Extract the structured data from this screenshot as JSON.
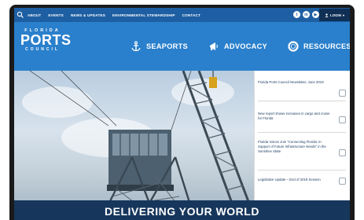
{
  "topbar": {
    "nav": [
      "ABOUT",
      "EVENTS",
      "NEWS & UPDATES",
      "ENVIRONMENTAL STEWARDSHIP",
      "CONTACT"
    ],
    "social": [
      {
        "icon": "twitter-icon",
        "glyph": "t"
      },
      {
        "icon": "linkedin-icon",
        "glyph": "in"
      },
      {
        "icon": "youtube-icon",
        "glyph": "▶"
      }
    ],
    "login_label": "LOGIN"
  },
  "logo": {
    "line1": "FLORIDA",
    "line2": "PORTS",
    "line3": "COUNCIL"
  },
  "mainnav": [
    "SEAPORTS",
    "ADVOCACY",
    "RESOURCES"
  ],
  "sidebar": {
    "items": [
      "Florida Ports Council Newsletter, June 2019",
      "New report shows increases in cargo and cruise for Florida",
      "Florida Voices Join \"Connecting Florida: In Support of Future Infrastructure Needs\" in the Sunshine State",
      "Legislative Update – End of 2019 Session"
    ]
  },
  "banner": {
    "headline": "DELIVERING YOUR WORLD",
    "subtext": ""
  },
  "colors": {
    "topbar": "#1e5fa3",
    "header": "#2a80cc",
    "banner": "#16365c",
    "login": "#0f2f55"
  }
}
